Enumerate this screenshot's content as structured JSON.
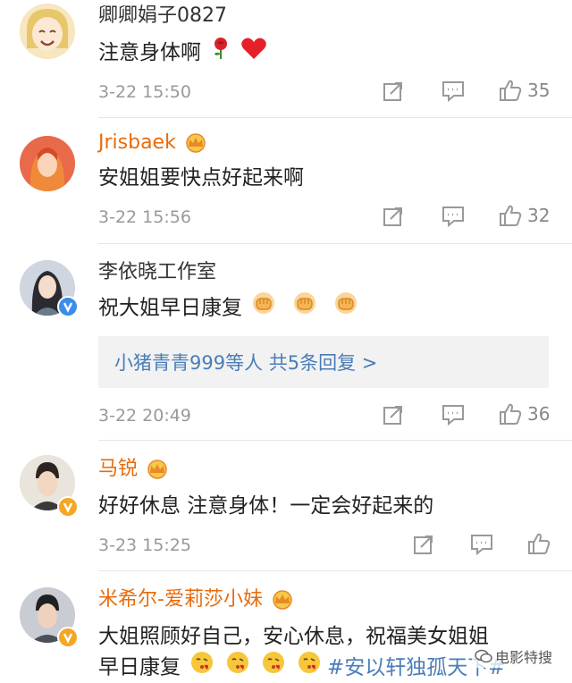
{
  "comments": [
    {
      "name": "卿卿娟子0827",
      "text": "注意身体啊",
      "emoji": [
        "rose-icon",
        "red-heart-icon"
      ],
      "time": "3-22 15:50",
      "likes": "35"
    },
    {
      "name": "Jrisbaek",
      "text": "安姐姐要快点好起来啊",
      "time": "3-22 15:56",
      "likes": "32"
    },
    {
      "name": "李依晓工作室",
      "text": "祝大姐早日康复",
      "emoji": [
        "fist-icon",
        "fist-icon",
        "fist-icon"
      ],
      "reply_summary": "小猪青青999等人 共5条回复 >",
      "time": "3-22 20:49",
      "likes": "36"
    },
    {
      "name": "马锐",
      "text": "好好休息 注意身体！一定会好起来的",
      "time": "3-23 15:25",
      "likes": ""
    },
    {
      "name": "米希尔-爱莉莎小妹",
      "text_line1": "大姐照顾好自己，安心休息，祝福美女姐姐",
      "text_line2": "早日康复",
      "emoji": [
        "blowing-kiss-icon",
        "blowing-kiss-icon",
        "blowing-kiss-icon",
        "blowing-kiss-icon"
      ],
      "hashtag": "#安以轩独孤天下#"
    }
  ],
  "watermark": "电影特搜",
  "colors": {
    "vip_name": "#e86b0c",
    "link": "#4a7db8",
    "meta": "#999999",
    "divider": "#e6e6e6"
  }
}
